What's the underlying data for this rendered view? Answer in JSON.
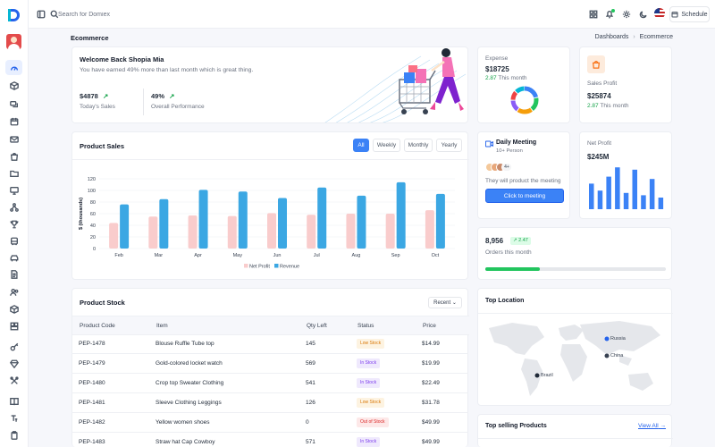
{
  "topbar": {
    "search_placeholder": "Search for Domiex",
    "schedule_label": "Schedule"
  },
  "page": {
    "title": "Ecommerce",
    "breadcrumb_parent": "Dashboards",
    "breadcrumb_current": "Ecommerce"
  },
  "welcome": {
    "title": "Welcome Back Shopia Mia",
    "subtitle": "You have earned 49% more than last month which is great thing.",
    "sales_value": "$4878",
    "sales_label": "Today's Sales",
    "perf_value": "49%",
    "perf_label": "Overall Performance"
  },
  "expense": {
    "label": "Expense",
    "value": "$18725",
    "delta": "2.87",
    "delta_suffix": "This month",
    "donut_colors": [
      "#3b82f6",
      "#22c55e",
      "#f59e0b",
      "#8b5cf6",
      "#ef4444",
      "#06b6d4"
    ],
    "donut_values": [
      22,
      18,
      20,
      15,
      12,
      13
    ]
  },
  "sales_profit": {
    "label": "Sales Profit",
    "value": "$25874",
    "delta": "2.87",
    "delta_suffix": "This month"
  },
  "product_sales": {
    "title": "Product Sales",
    "tabs": [
      "All",
      "Weekly",
      "Monthly",
      "Yearly"
    ],
    "active_tab": 0
  },
  "chart_data": {
    "type": "bar",
    "categories": [
      "Feb",
      "Mar",
      "Apr",
      "May",
      "Jun",
      "Jul",
      "Aug",
      "Sep",
      "Oct"
    ],
    "x_tick_labels": [
      "Feb",
      "Mar",
      "Apr",
      "May",
      "Jun",
      "Jul",
      "Aug",
      "Sep",
      "Oct"
    ],
    "series": [
      {
        "name": "Net Profit",
        "color": "#f9cccc",
        "values": [
          44,
          55,
          57,
          56,
          61,
          58,
          60,
          60,
          66
        ]
      },
      {
        "name": "Revenue",
        "color": "#3ba7e3",
        "values": [
          76,
          85,
          101,
          98,
          87,
          105,
          91,
          114,
          94
        ]
      }
    ],
    "ylabel": "$ (thousands)",
    "ylim": [
      0,
      120
    ],
    "yticks": [
      "0",
      "20",
      "40",
      "60",
      "80",
      "100",
      "120"
    ],
    "grid": true,
    "legend": "bottom"
  },
  "meeting": {
    "title": "Daily Meeting",
    "subtitle": "10+ Person",
    "extra": "4+",
    "text": "They will product the meeting",
    "button": "Click to meeting"
  },
  "net_profit": {
    "label": "Net Profit",
    "value": "$245M",
    "bar_values": [
      0.55,
      0.4,
      0.7,
      0.9,
      0.35,
      0.85,
      0.3,
      0.65,
      0.25
    ]
  },
  "orders": {
    "value": "8,956",
    "delta": "2.47",
    "label": "Orders this month",
    "progress": 0.3
  },
  "stock": {
    "title": "Product Stock",
    "filter": "Recent",
    "columns": [
      "Product Code",
      "Item",
      "Qty Left",
      "Status",
      "Price"
    ],
    "rows": [
      {
        "code": "PEP-1478",
        "item": "Blouse Ruffle Tube top",
        "qty": "145",
        "status": "Low Stock",
        "price": "$14.99"
      },
      {
        "code": "PEP-1479",
        "item": "Gold-colored locket watch",
        "qty": "569",
        "status": "In Stock",
        "price": "$19.99"
      },
      {
        "code": "PEP-1480",
        "item": "Crop top Sweater Clothing",
        "qty": "541",
        "status": "In Stock",
        "price": "$22.49"
      },
      {
        "code": "PEP-1481",
        "item": "Sleeve Clothing Leggings",
        "qty": "126",
        "status": "Low Stock",
        "price": "$31.78"
      },
      {
        "code": "PEP-1482",
        "item": "Yellow women shoes",
        "qty": "0",
        "status": "Out of Stock",
        "price": "$49.99"
      },
      {
        "code": "PEP-1483",
        "item": "Straw hat Cap Cowboy",
        "qty": "571",
        "status": "In Stock",
        "price": "$49.99"
      }
    ]
  },
  "location": {
    "title": "Top Location",
    "pins": [
      "Russia",
      "China",
      "Brazil"
    ]
  },
  "top_selling": {
    "title": "Top selling Products",
    "view_all": "View All"
  }
}
